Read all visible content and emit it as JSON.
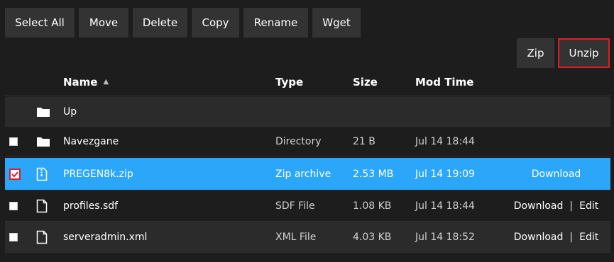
{
  "toolbar": {
    "select_all": "Select All",
    "move": "Move",
    "delete": "Delete",
    "copy": "Copy",
    "rename": "Rename",
    "wget": "Wget",
    "zip": "Zip",
    "unzip": "Unzip"
  },
  "columns": {
    "name": "Name",
    "sort_indicator": "▲",
    "type": "Type",
    "size": "Size",
    "mod_time": "Mod Time"
  },
  "up_row": {
    "label": "Up",
    "icon": "folder-icon"
  },
  "files": [
    {
      "name": "Navezgane",
      "type": "Directory",
      "size": "21 B",
      "mod_time": "Jul 14 18:44",
      "icon": "folder-icon",
      "checked": false,
      "download": "",
      "edit": ""
    },
    {
      "name": "PREGEN8k.zip",
      "type": "Zip archive",
      "size": "2.53 MB",
      "mod_time": "Jul 14 19:09",
      "icon": "zip-file-icon",
      "checked": true,
      "download": "Download",
      "edit": ""
    },
    {
      "name": "profiles.sdf",
      "type": "SDF File",
      "size": "1.08 KB",
      "mod_time": "Jul 14 18:44",
      "icon": "file-icon",
      "checked": false,
      "download": "Download",
      "edit": "Edit"
    },
    {
      "name": "serveradmin.xml",
      "type": "XML File",
      "size": "4.03 KB",
      "mod_time": "Jul 14 18:52",
      "icon": "file-icon",
      "checked": false,
      "download": "Download",
      "edit": "Edit"
    }
  ],
  "action_separator": "|",
  "colors": {
    "background": "#1d1d1d",
    "button": "#333333",
    "selected_row": "#2ba6f8",
    "highlight_border": "#e01b24"
  }
}
